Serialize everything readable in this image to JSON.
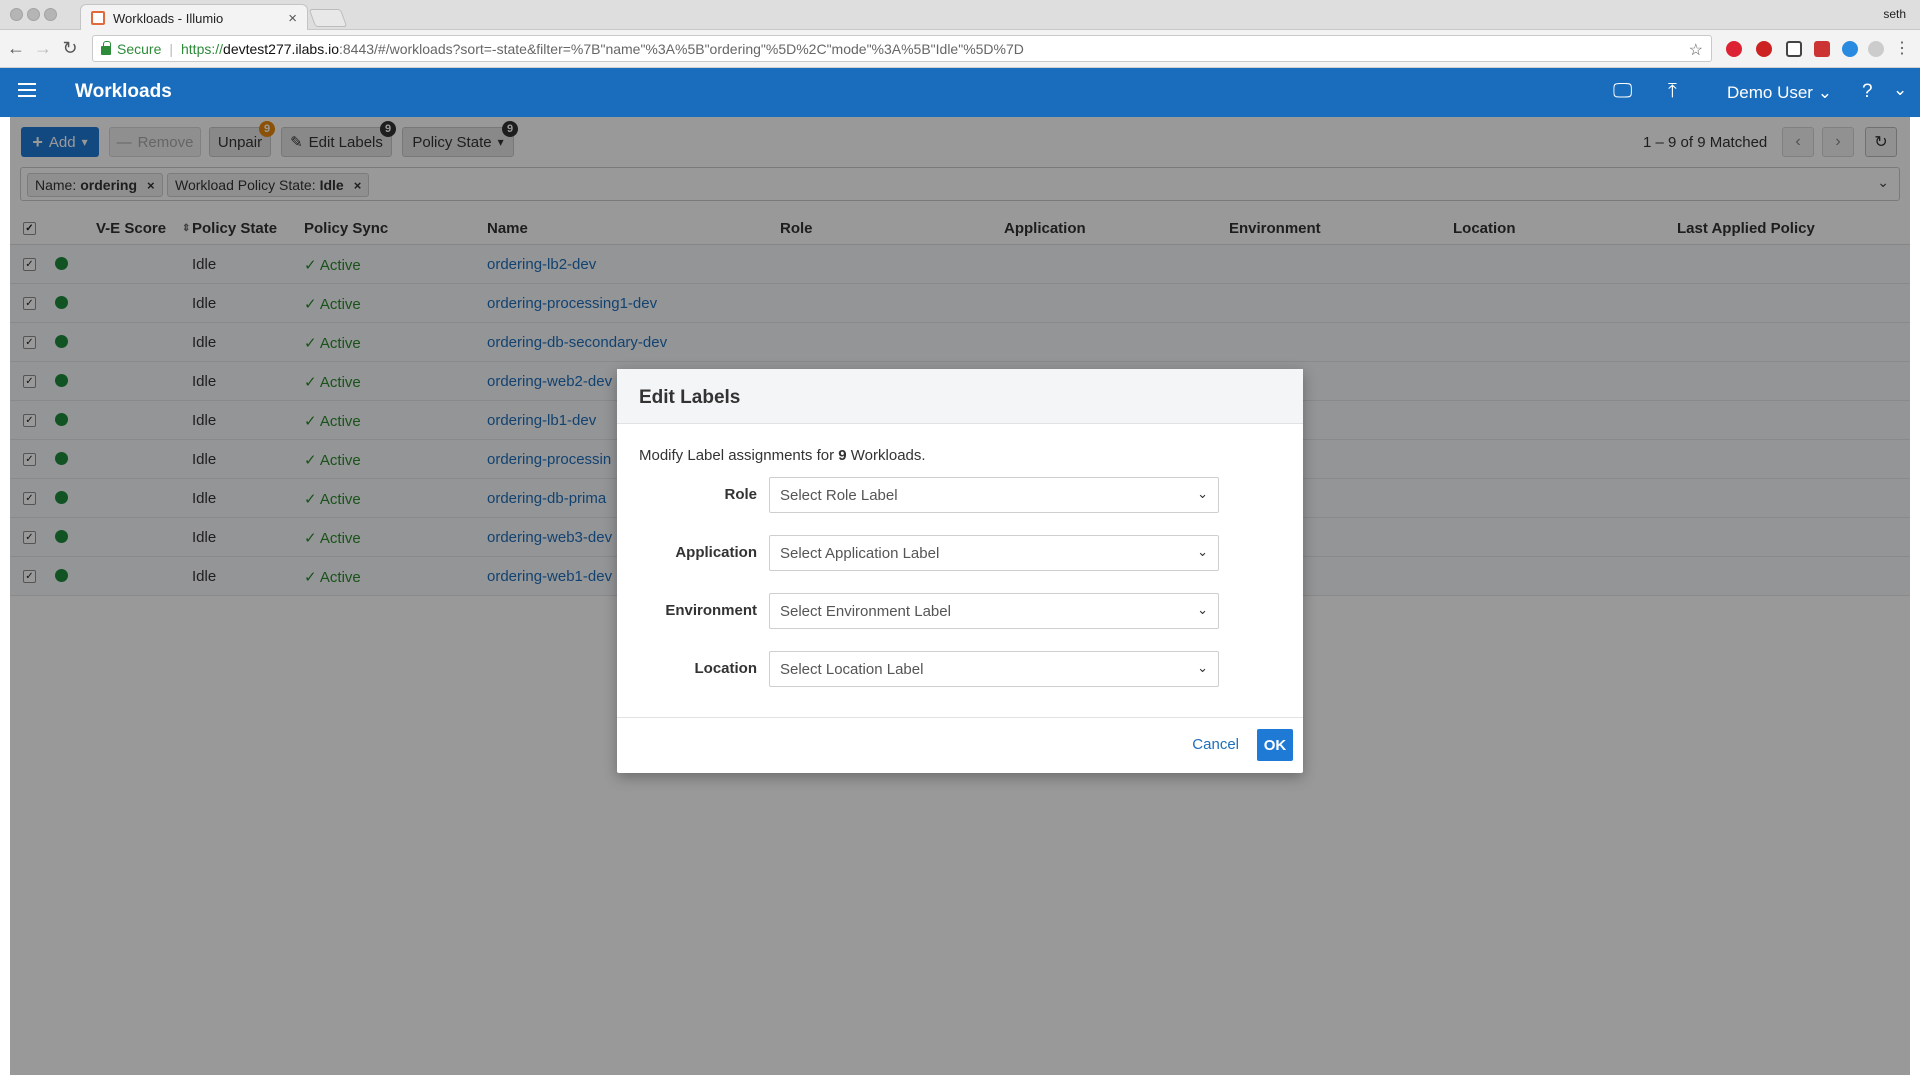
{
  "browser": {
    "tab_title": "Workloads - Illumio",
    "user_name": "seth",
    "secure_label": "Secure",
    "url_scheme": "https://",
    "url_host": "devtest277.ilabs.io",
    "url_rest": ":8443/#/workloads?sort=-state&filter=%7B\"name\"%3A%5B\"ordering\"%5D%2C\"mode\"%3A%5B\"Idle\"%5D%7D"
  },
  "header": {
    "title": "Workloads",
    "user": "Demo User",
    "help": "?"
  },
  "toolbar": {
    "add_label": "Add",
    "remove_label": "Remove",
    "unpair_label": "Unpair",
    "unpair_badge": "9",
    "edit_labels_label": "Edit Labels",
    "edit_labels_badge": "9",
    "policy_state_label": "Policy State",
    "policy_state_badge": "9",
    "matched": "1 – 9 of 9 Matched"
  },
  "filters": [
    {
      "key": "Name:",
      "value": "ordering"
    },
    {
      "key": "Workload Policy State:",
      "value": "Idle"
    }
  ],
  "table": {
    "columns": [
      "V-E Score",
      "Policy State",
      "Policy Sync",
      "Name",
      "Role",
      "Application",
      "Environment",
      "Location",
      "Last Applied Policy"
    ],
    "rows": [
      {
        "state": "Idle",
        "sync": "Active",
        "name": "ordering-lb2-dev"
      },
      {
        "state": "Idle",
        "sync": "Active",
        "name": "ordering-processing1-dev"
      },
      {
        "state": "Idle",
        "sync": "Active",
        "name": "ordering-db-secondary-dev"
      },
      {
        "state": "Idle",
        "sync": "Active",
        "name": "ordering-web2-dev"
      },
      {
        "state": "Idle",
        "sync": "Active",
        "name": "ordering-lb1-dev"
      },
      {
        "state": "Idle",
        "sync": "Active",
        "name": "ordering-processin"
      },
      {
        "state": "Idle",
        "sync": "Active",
        "name": "ordering-db-prima"
      },
      {
        "state": "Idle",
        "sync": "Active",
        "name": "ordering-web3-dev"
      },
      {
        "state": "Idle",
        "sync": "Active",
        "name": "ordering-web1-dev"
      }
    ]
  },
  "modal": {
    "title": "Edit Labels",
    "text_prefix": "Modify Label assignments for",
    "count": "9",
    "text_suffix": "Workloads.",
    "fields": [
      {
        "label": "Role",
        "placeholder": "Select Role Label"
      },
      {
        "label": "Application",
        "placeholder": "Select Application Label"
      },
      {
        "label": "Environment",
        "placeholder": "Select Environment Label"
      },
      {
        "label": "Location",
        "placeholder": "Select Location Label"
      }
    ],
    "cancel_label": "Cancel",
    "ok_label": "OK"
  },
  "colors": {
    "header_bg": "#1a6dbd",
    "primary": "#1f7ad6",
    "status_green": "#1f8a3c",
    "badge_orange": "#e8890c"
  }
}
